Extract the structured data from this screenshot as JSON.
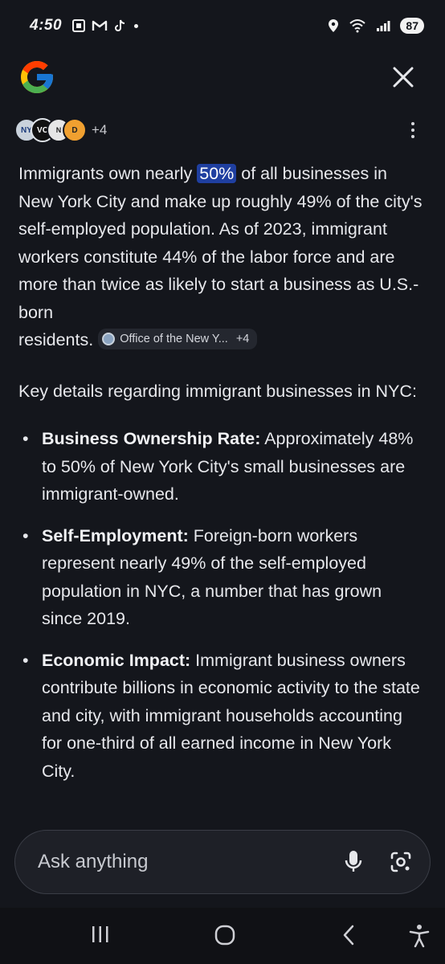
{
  "status_bar": {
    "time": "4:50",
    "battery": "87",
    "icons": [
      "screenshot-icon",
      "gmail-icon",
      "tiktok-icon",
      "location-icon",
      "wifi-icon",
      "signal-icon"
    ]
  },
  "sources": {
    "more_count": "+4",
    "avatars": [
      "NY",
      "VC",
      "N",
      "D"
    ]
  },
  "answer": {
    "p1_before": "Immigrants own nearly ",
    "p1_highlight": "50%",
    "p1_after": " of all businesses in New York City and make up roughly 49% of the city's self-employed population. As of 2023, immigrant workers constitute 44% of the labor force and are more than twice as likely to start a business as U.S.-born",
    "p1_end": "residents.",
    "citation_label": "Office of the New Y...",
    "citation_more": "+4",
    "intro2": "Key details regarding immigrant businesses in NYC:",
    "bullet_char": "•",
    "bullets": [
      {
        "title": "Business Ownership Rate:",
        "text": " Approximately 48% to 50% of New York City's small businesses are immigrant-owned."
      },
      {
        "title": "Self-Employment:",
        "text": " Foreign-born workers represent nearly 49% of the self-employed population in NYC, a number that has grown since 2019."
      },
      {
        "title": "Economic Impact:",
        "text": " Immigrant business owners contribute billions in economic activity to the state and city, with immigrant households accounting for one-third of all earned income in New York City."
      }
    ]
  },
  "ask_bar": {
    "placeholder": "Ask anything",
    "icons": [
      "microphone-icon",
      "lens-camera-icon"
    ]
  },
  "nav_bar": {
    "icons": [
      "recents-icon",
      "home-icon",
      "back-icon",
      "accessibility-icon"
    ]
  },
  "colors": {
    "background": "#14161c",
    "highlight": "#1f3fa0",
    "text": "#e7e8ec"
  }
}
